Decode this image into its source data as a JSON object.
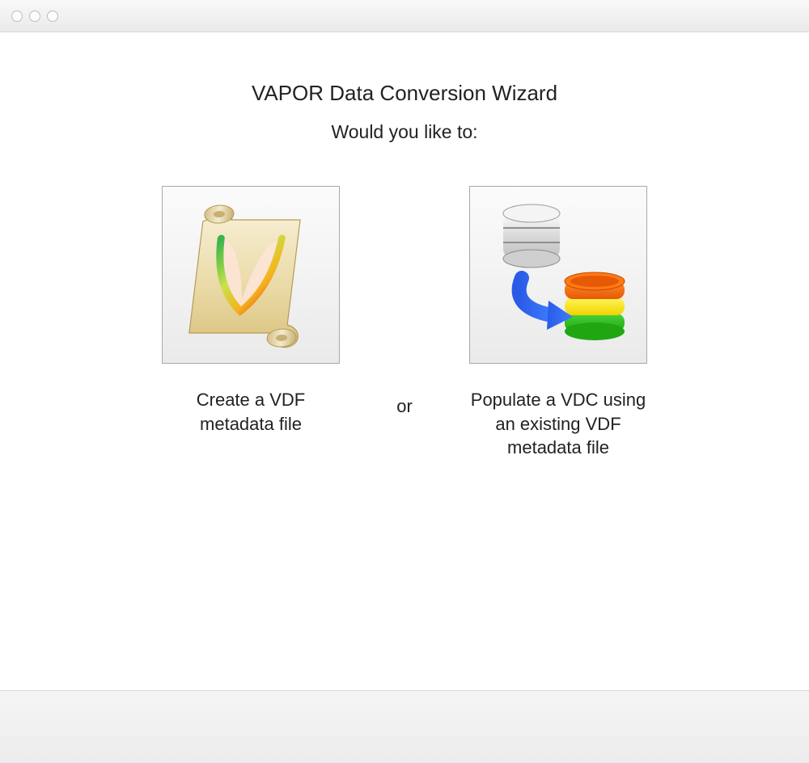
{
  "heading": {
    "title": "VAPOR Data Conversion Wizard",
    "subtitle": "Would you like to:"
  },
  "options": {
    "create_label": "Create a VDF metadata file",
    "or_label": "or",
    "populate_label": "Populate a VDC using an existing VDF metadata file"
  },
  "icons": {
    "scroll": "scroll-icon",
    "database": "database-transfer-icon"
  }
}
